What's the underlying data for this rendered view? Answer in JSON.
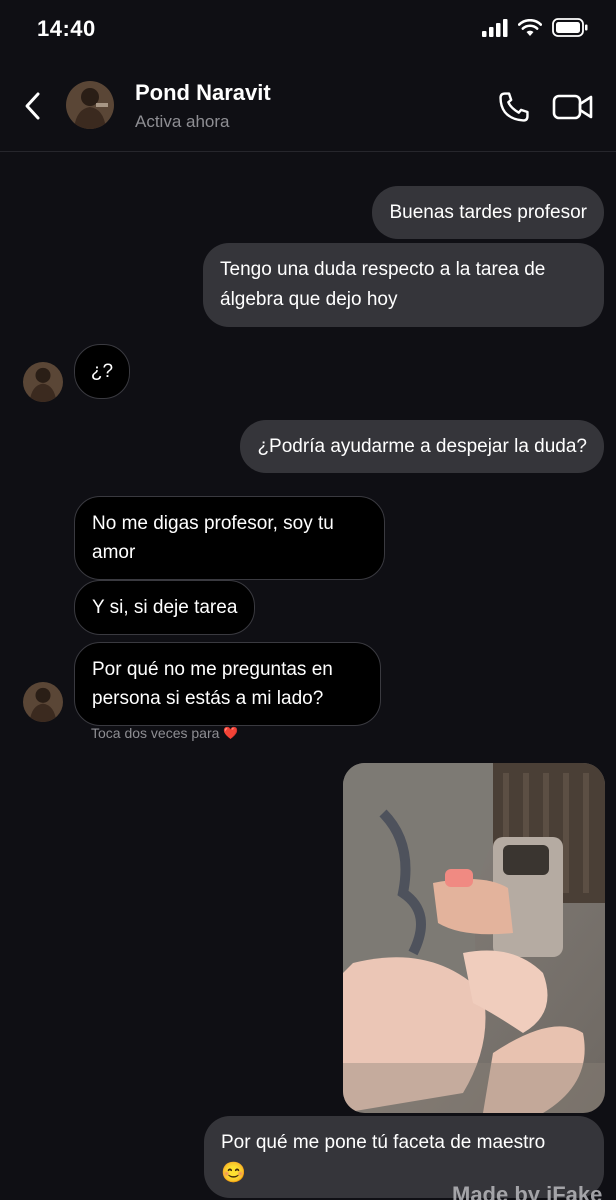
{
  "status_bar": {
    "time": "14:40",
    "icons": [
      "cellular-signal-icon",
      "wifi-icon",
      "battery-icon"
    ]
  },
  "header": {
    "contact_name": "Pond Naravit",
    "contact_status": "Activa ahora",
    "icons": [
      "back-chevron-icon",
      "phone-icon",
      "video-camera-icon"
    ]
  },
  "messages": [
    {
      "direction": "outgoing",
      "text": "Buenas tardes profesor"
    },
    {
      "direction": "outgoing",
      "lines": [
        "Tengo una duda respecto a la tarea de",
        "álgebra que dejo hoy"
      ]
    },
    {
      "direction": "incoming",
      "text": "¿?"
    },
    {
      "direction": "outgoing",
      "text": "¿Podría ayudarme a despejar la duda?"
    },
    {
      "direction": "incoming",
      "lines": [
        "No me digas profesor, soy tu",
        "amor"
      ]
    },
    {
      "direction": "incoming",
      "text": "Y si, si deje tarea"
    },
    {
      "direction": "incoming",
      "lines": [
        "Por qué no me preguntas en",
        "persona si estás a mi lado?"
      ]
    },
    {
      "direction": "outgoing",
      "type": "photo"
    },
    {
      "direction": "outgoing",
      "text": "Por qué me pone tú faceta de maestro",
      "emoji": "😊"
    }
  ],
  "hint": {
    "text": "Toca dos veces para",
    "emoji": "❤️"
  },
  "watermark": "Made by iFake",
  "colors": {
    "background": "#0f0f14",
    "outgoing_bubble": "#35353a",
    "incoming_bubble": "#000000",
    "secondary_text": "#8e8e93"
  }
}
